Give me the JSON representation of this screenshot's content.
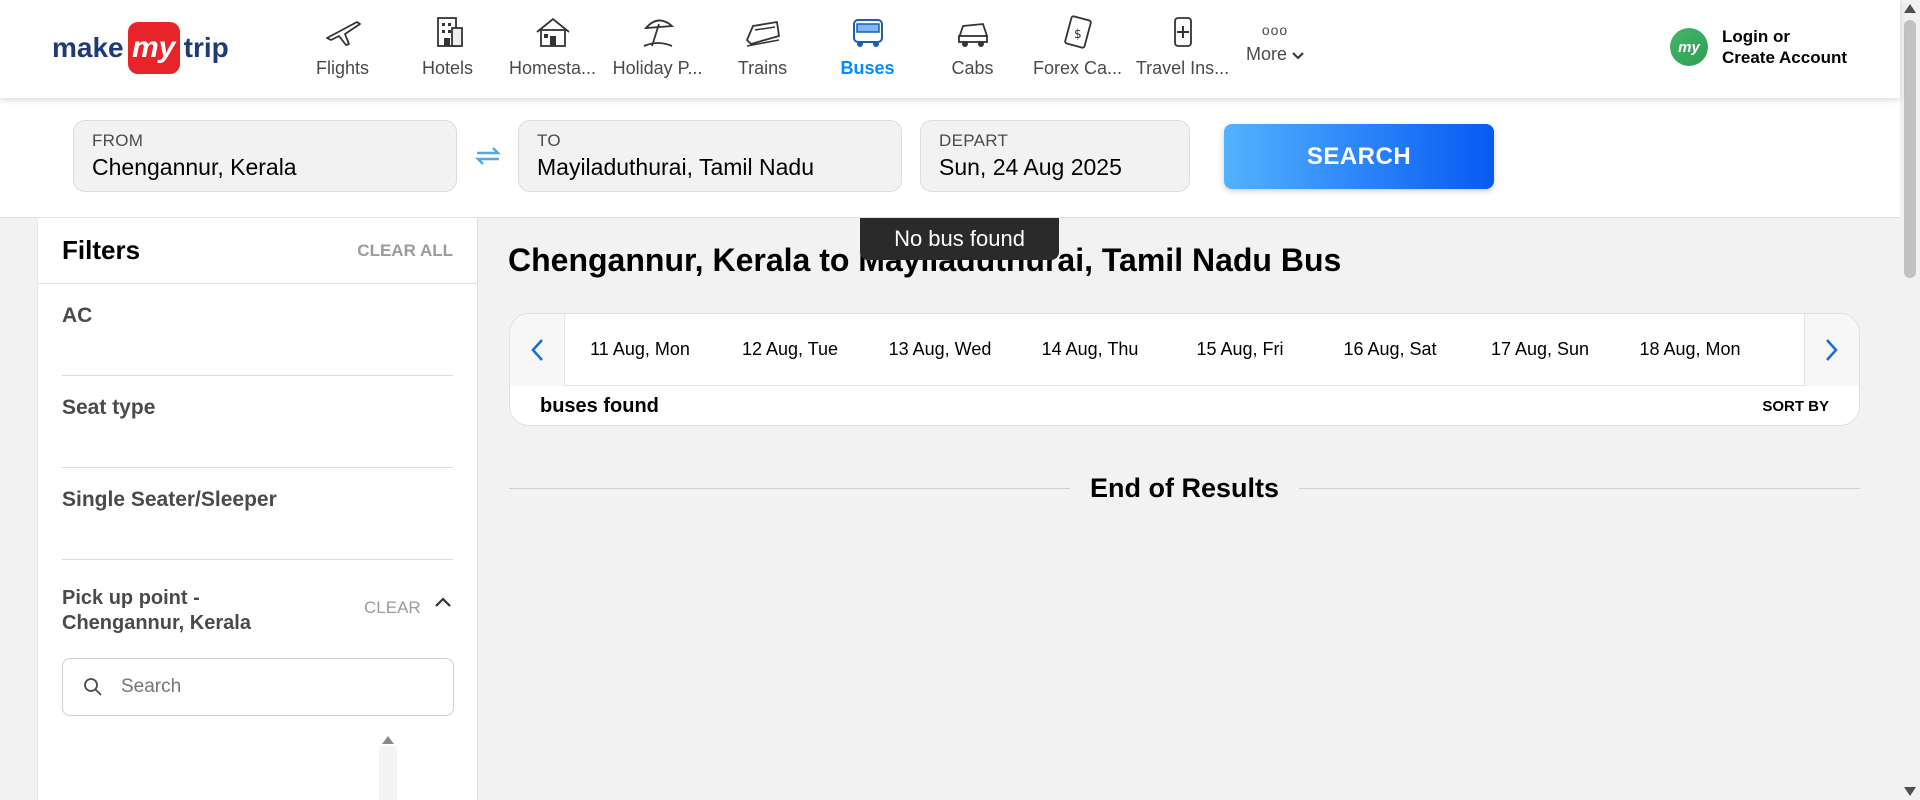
{
  "logo": {
    "make": "make",
    "my": "my",
    "trip": "trip"
  },
  "nav": {
    "items": [
      {
        "label": "Flights",
        "icon": "flight-icon"
      },
      {
        "label": "Hotels",
        "icon": "hotel-icon"
      },
      {
        "label": "Homesta...",
        "icon": "homestay-icon"
      },
      {
        "label": "Holiday P...",
        "icon": "holiday-icon"
      },
      {
        "label": "Trains",
        "icon": "train-icon"
      },
      {
        "label": "Buses",
        "icon": "bus-icon",
        "active": true
      },
      {
        "label": "Cabs",
        "icon": "cab-icon"
      },
      {
        "label": "Forex Ca...",
        "icon": "forex-icon"
      },
      {
        "label": "Travel Ins...",
        "icon": "insurance-icon"
      }
    ],
    "more_dots": "ooo",
    "more_label": "More"
  },
  "login": {
    "avatar": "my",
    "line1": "Login or",
    "line2": "Create Account"
  },
  "search": {
    "from_label": "FROM",
    "from_value": "Chengannur, Kerala",
    "to_label": "TO",
    "to_value": "Mayiladuthurai, Tamil Nadu",
    "depart_label": "DEPART",
    "depart_value": "Sun, 24 Aug 2025",
    "button": "SEARCH"
  },
  "filters": {
    "title": "Filters",
    "clear_all": "CLEAR ALL",
    "sections": [
      "AC",
      "Seat type",
      "Single Seater/Sleeper"
    ],
    "pickup_title": "Pick up point - Chengannur, Kerala",
    "pickup_clear": "CLEAR",
    "pickup_search_placeholder": "Search"
  },
  "main": {
    "toast": "No bus found",
    "title": "Chengannur, Kerala to Mayiladuthurai, Tamil Nadu Bus",
    "dates": [
      "11 Aug, Mon",
      "12 Aug, Tue",
      "13 Aug, Wed",
      "14 Aug, Thu",
      "15 Aug, Fri",
      "16 Aug, Sat",
      "17 Aug, Sun",
      "18 Aug, Mon"
    ],
    "buses_found": "buses found",
    "sort_by": "SORT BY",
    "end_of_results": "End of Results"
  },
  "colors": {
    "brand_red": "#e8242b",
    "brand_blue": "#1e3a78",
    "accent": "#008cff",
    "button_start": "#53b2fe",
    "button_end": "#065af3"
  }
}
